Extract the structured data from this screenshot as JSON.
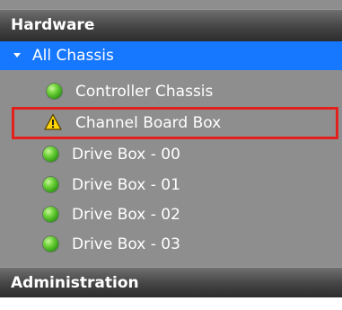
{
  "sections": {
    "hardware": "Hardware",
    "administration": "Administration"
  },
  "group": {
    "label": "All Chassis",
    "expanded": true
  },
  "items": [
    {
      "label": "Controller Chassis",
      "status": "ok",
      "icon": "green-status-icon"
    },
    {
      "label": "Channel Board Box",
      "status": "warning",
      "icon": "warning-triangle-icon",
      "selected": true
    },
    {
      "label": "Drive Box - 00",
      "status": "ok",
      "icon": "green-status-icon"
    },
    {
      "label": "Drive Box - 01",
      "status": "ok",
      "icon": "green-status-icon"
    },
    {
      "label": "Drive Box - 02",
      "status": "ok",
      "icon": "green-status-icon"
    },
    {
      "label": "Drive Box - 03",
      "status": "ok",
      "icon": "green-status-icon"
    }
  ],
  "colors": {
    "panel_background": "#8e8e8e",
    "group_highlight": "#1677ff",
    "selection_border": "#e3201b",
    "ok_status": "#3fae1c",
    "warning_status": "#ffd400"
  }
}
